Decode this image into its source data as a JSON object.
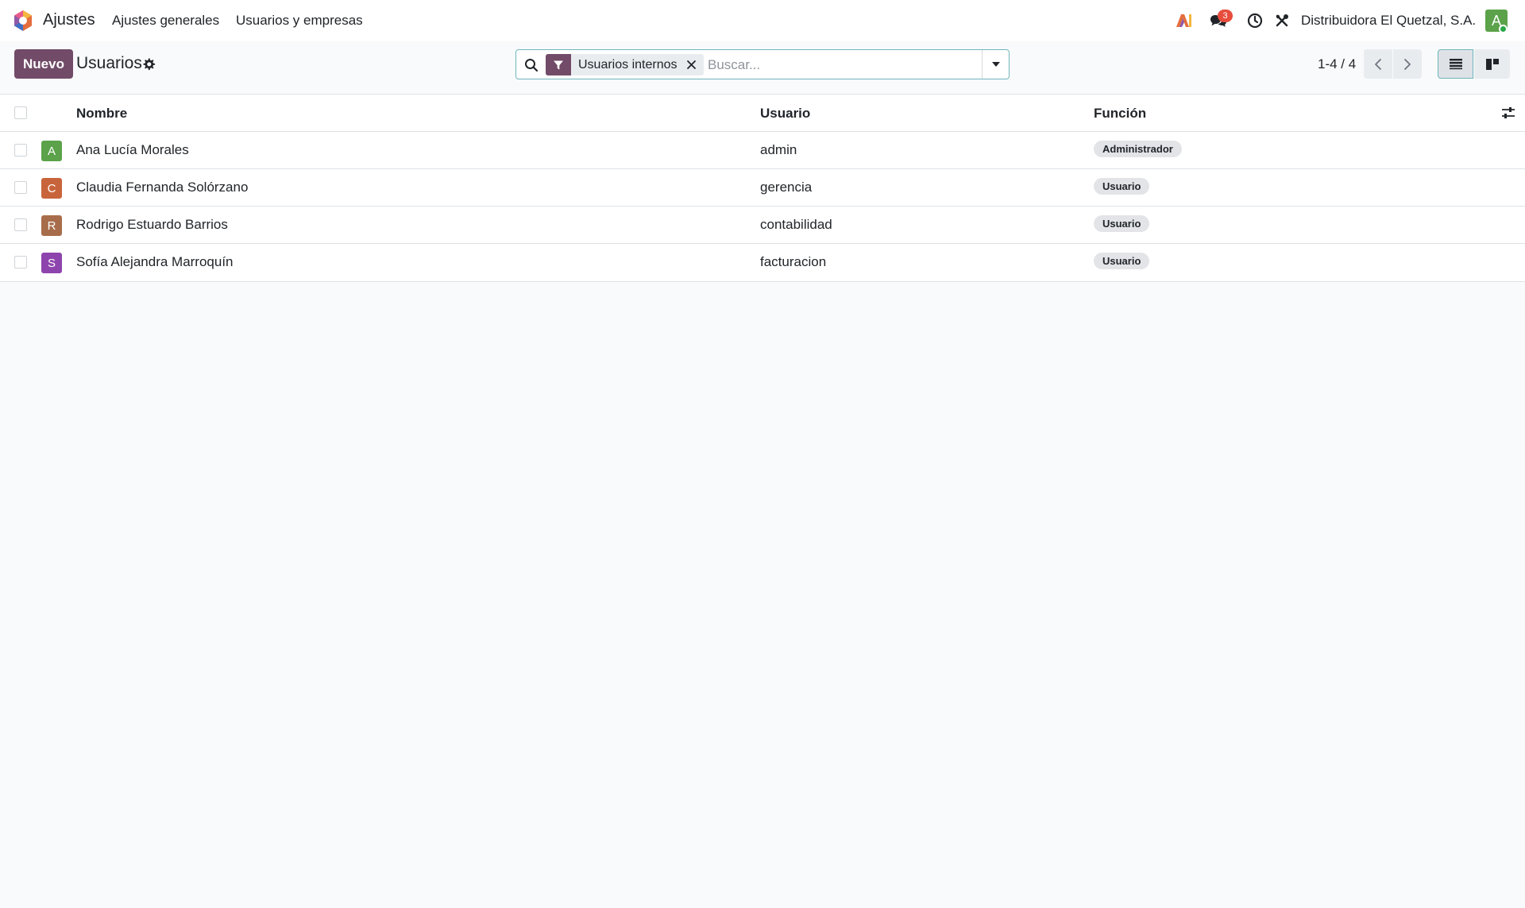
{
  "navbar": {
    "app_name": "Ajustes",
    "menus": [
      "Ajustes generales",
      "Usuarios y empresas"
    ],
    "chat_count": "3",
    "company": "Distribuidora El Quetzal, S.A.",
    "user_initial": "A"
  },
  "control_panel": {
    "new_label": "Nuevo",
    "title": "Usuarios",
    "facet_label": "Usuarios internos",
    "search_placeholder": "Buscar...",
    "pager": "1-4 / 4"
  },
  "table": {
    "headers": {
      "name": "Nombre",
      "login": "Usuario",
      "role": "Función"
    },
    "rows": [
      {
        "initial": "A",
        "name": "Ana Lucía Morales",
        "login": "admin",
        "role": "Administrador",
        "avatar_color": "#5ba24a"
      },
      {
        "initial": "C",
        "name": "Claudia Fernanda Solórzano",
        "login": "gerencia",
        "role": "Usuario",
        "avatar_color": "#c8643b"
      },
      {
        "initial": "R",
        "name": "Rodrigo Estuardo Barrios",
        "login": "contabilidad",
        "role": "Usuario",
        "avatar_color": "#a76d4b"
      },
      {
        "initial": "S",
        "name": "Sofía Alejandra Marroquín",
        "login": "facturacion",
        "role": "Usuario",
        "avatar_color": "#8e44ad"
      }
    ]
  },
  "colors": {
    "brand": "#714b67",
    "focus_border": "#6fb6bd",
    "badge_red": "#e74c3c",
    "online_green": "#28a745"
  },
  "icons": {
    "app_logo": "app-logo-icon",
    "ai": "ai-icon",
    "chat": "chat-icon",
    "activity": "clock-icon",
    "debug": "debug-tools-icon",
    "gear": "gear-icon",
    "search": "search-icon",
    "filter": "filter-icon",
    "remove": "close-icon",
    "toggle": "caret-down-icon",
    "prev": "chevron-left-icon",
    "next": "chevron-right-icon",
    "list_view": "list-view-icon",
    "kanban_view": "kanban-view-icon",
    "optional_columns": "sliders-icon"
  }
}
